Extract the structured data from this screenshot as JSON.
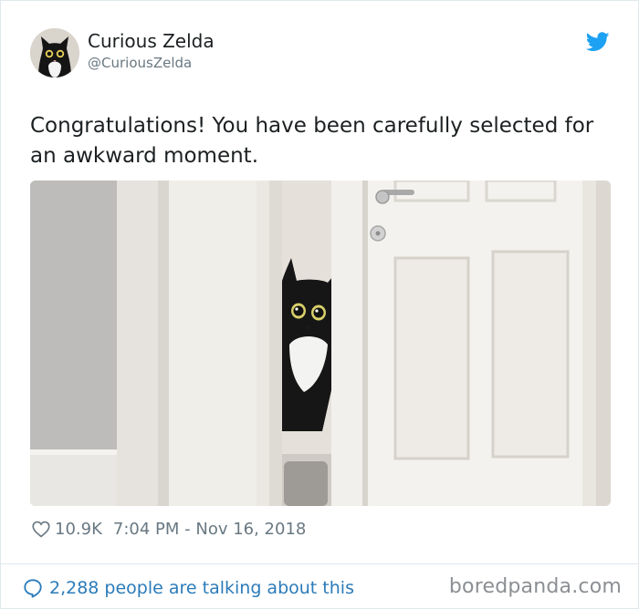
{
  "author": {
    "display_name": "Curious Zelda",
    "handle": "@CuriousZelda"
  },
  "tweet": {
    "text": "Congratulations! You have been carefully selected for an awkward moment.",
    "photo_description": "",
    "likes": "10.9K",
    "timestamp": "7:04 PM - Nov 16, 2018"
  },
  "footer": {
    "talking_label": "2,288 people are talking about this"
  },
  "watermark": "boredpanda.com",
  "icons": {
    "brand": "twitter-bird-icon",
    "like": "heart-icon",
    "reply": "speech-bubble-icon"
  },
  "colors": {
    "brand": "#1da1f2",
    "link": "#2b7bb9",
    "muted": "#697882",
    "text": "#1c2022",
    "border": "#e1e8ed"
  }
}
